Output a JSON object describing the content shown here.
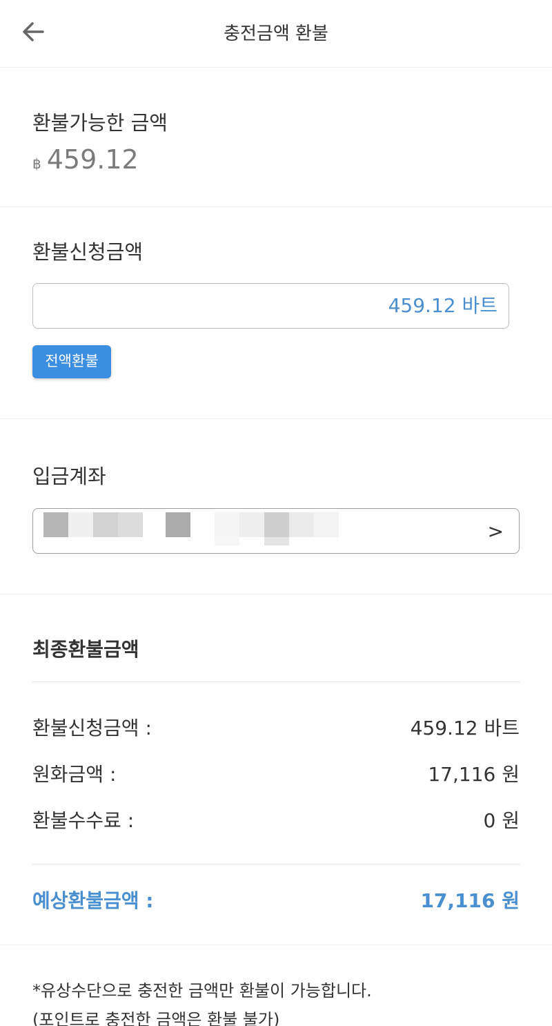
{
  "header": {
    "title": "충전금액 환불",
    "back_icon": "arrow-left-icon"
  },
  "available": {
    "label": "환불가능한 금액",
    "currency_symbol": "฿",
    "amount": "459.12"
  },
  "request": {
    "label": "환불신청금액",
    "input_value": "459.12 바트",
    "full_refund_label": "전액환불"
  },
  "account": {
    "label": "입금계좌",
    "chevron": ">"
  },
  "final": {
    "title": "최종환불금액",
    "rows": [
      {
        "label": "환불신청금액 :",
        "value": "459.12 바트"
      },
      {
        "label": "원화금액 :",
        "value": "17,116 원"
      },
      {
        "label": "환불수수료 :",
        "value": "0 원"
      }
    ],
    "total": {
      "label": "예상환불금액 :",
      "value": "17,116 원"
    }
  },
  "notes": [
    "*유상수단으로 충전한 금액만 환불이 가능합니다.",
    "(포인트로 충전한 금액은 환불 불가)"
  ],
  "colors": {
    "accent": "#3c8ee0",
    "accent_text": "#4a8fd0",
    "muted": "#7b7b7b"
  }
}
